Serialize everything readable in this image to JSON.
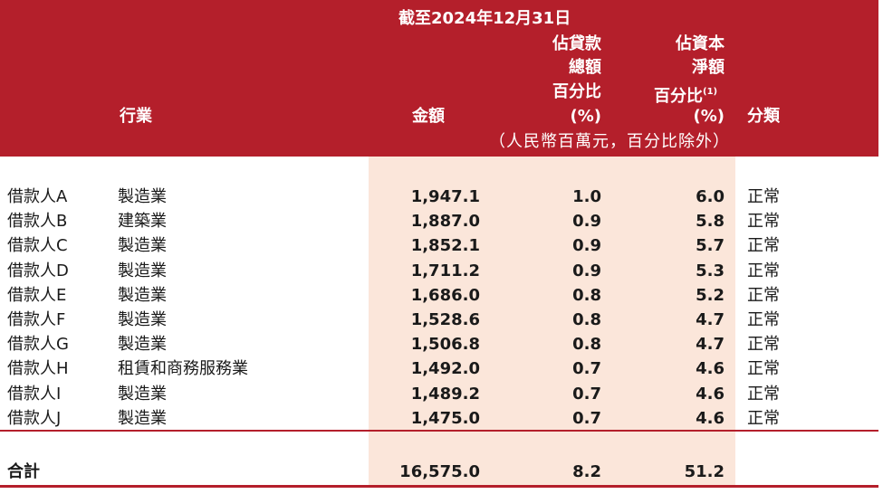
{
  "header": {
    "date_heading": "截至2024年12月31日",
    "col_industry": "行業",
    "col_amount": "金額",
    "col_loan_pct": [
      "佔貸款",
      "總額",
      "百分比",
      "(%)"
    ],
    "col_capital_pct": [
      "佔資本",
      "淨額",
      "百分比",
      "(%)"
    ],
    "capital_note_mark": "(1)",
    "col_class": "分類",
    "unit_note": "（人民幣百萬元，百分比除外）"
  },
  "rows": [
    {
      "name": "借款人A",
      "industry": "製造業",
      "amount": "1,947.1",
      "loan_pct": "1.0",
      "capital_pct": "6.0",
      "class": "正常"
    },
    {
      "name": "借款人B",
      "industry": "建築業",
      "amount": "1,887.0",
      "loan_pct": "0.9",
      "capital_pct": "5.8",
      "class": "正常"
    },
    {
      "name": "借款人C",
      "industry": "製造業",
      "amount": "1,852.1",
      "loan_pct": "0.9",
      "capital_pct": "5.7",
      "class": "正常"
    },
    {
      "name": "借款人D",
      "industry": "製造業",
      "amount": "1,711.2",
      "loan_pct": "0.9",
      "capital_pct": "5.3",
      "class": "正常"
    },
    {
      "name": "借款人E",
      "industry": "製造業",
      "amount": "1,686.0",
      "loan_pct": "0.8",
      "capital_pct": "5.2",
      "class": "正常"
    },
    {
      "name": "借款人F",
      "industry": "製造業",
      "amount": "1,528.6",
      "loan_pct": "0.8",
      "capital_pct": "4.7",
      "class": "正常"
    },
    {
      "name": "借款人G",
      "industry": "製造業",
      "amount": "1,506.8",
      "loan_pct": "0.8",
      "capital_pct": "4.7",
      "class": "正常"
    },
    {
      "name": "借款人H",
      "industry": "租賃和商務服務業",
      "amount": "1,492.0",
      "loan_pct": "0.7",
      "capital_pct": "4.6",
      "class": "正常"
    },
    {
      "name": "借款人I",
      "industry": "製造業",
      "amount": "1,489.2",
      "loan_pct": "0.7",
      "capital_pct": "4.6",
      "class": "正常"
    },
    {
      "name": "借款人J",
      "industry": "製造業",
      "amount": "1,475.0",
      "loan_pct": "0.7",
      "capital_pct": "4.6",
      "class": "正常"
    }
  ],
  "total": {
    "label": "合計",
    "amount": "16,575.0",
    "loan_pct": "8.2",
    "capital_pct": "51.2"
  },
  "colors": {
    "header_bg": "#b41f2b",
    "shade": "#fbe6da"
  }
}
